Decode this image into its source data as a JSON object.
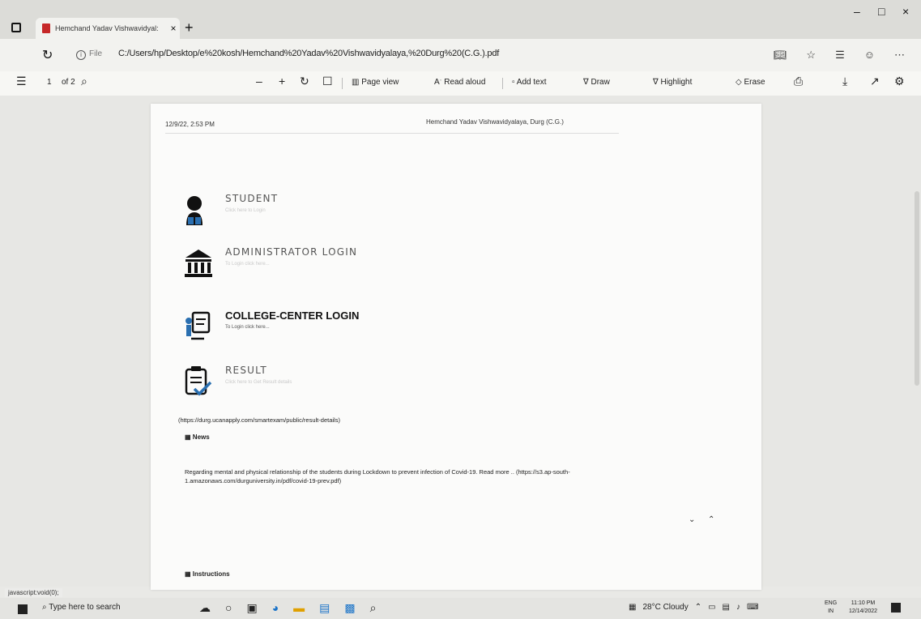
{
  "browser": {
    "tab_title": "Hemchand Yadav Vishwavidyal:",
    "tab_close": "×",
    "new_tab": "+",
    "scheme": "File",
    "url": "C:/Users/hp/Desktop/e%20kosh/Hemchand%20Yadav%20Vishwavidyalaya,%20Durg%20(C.G.).pdf",
    "window_controls": [
      "–",
      "□",
      "×"
    ]
  },
  "pdf_toolbar": {
    "page_current": "1",
    "page_total": "of 2",
    "zoom_out": "–",
    "zoom_in": "+",
    "page_view": "Page view",
    "read_aloud": "Read aloud",
    "add_text": "Add text",
    "draw": "Draw",
    "highlight": "Highlight",
    "erase": "Erase"
  },
  "document": {
    "date": "12/9/22, 2:53 PM",
    "header": "Hemchand Yadav Vishwavidyalaya, Durg (C.G.)",
    "menu": [
      {
        "title": "STUDENT",
        "subtitle": "Click here to Login"
      },
      {
        "title": "ADMINISTRATOR LOGIN",
        "subtitle": "To Login click here..."
      },
      {
        "title": "COLLEGE-CENTER LOGIN",
        "subtitle": "To Login click here..."
      },
      {
        "title": "RESULT",
        "subtitle": "Click here to Get Result details"
      }
    ],
    "result_link": "(https://durg.ucanapply.com/smartexam/public/result-details)",
    "news_heading": "News",
    "news_text": "Regarding mental and physical relationship of the students during Lockdown to prevent infection of Covid-19.   Read more .. (https://s3.ap-south-1.amazonaws.com/durguniversity.in/pdf/covid-19-prev.pdf)",
    "instructions_heading": "Instructions"
  },
  "status_link": "javascript:void(0);",
  "taskbar": {
    "search_placeholder": "Type here to search",
    "weather": "28°C Cloudy",
    "lang_top": "ENG",
    "lang_bottom": "IN",
    "time": "11:10 PM",
    "date": "12/14/2022"
  }
}
